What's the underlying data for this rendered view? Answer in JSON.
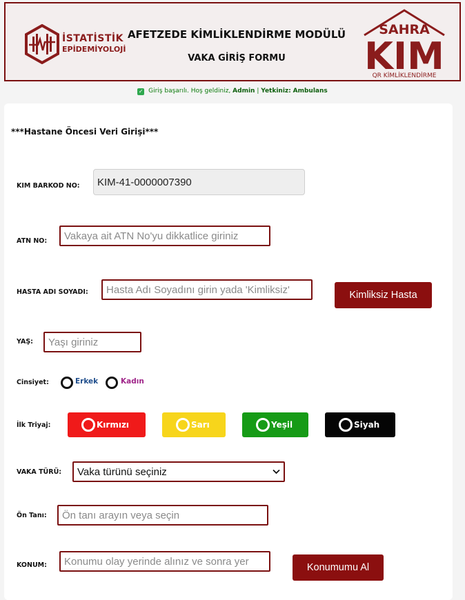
{
  "header": {
    "left_logo_line1": "İSTATİSTİK",
    "left_logo_line2": "EPİDEMİYOLOJİ",
    "title": "AFETZEDE KİMLİKLENDİRME MODÜLÜ",
    "subtitle": "VAKA GİRİŞ FORMU",
    "right_logo_top": "SAHRA",
    "right_logo_main": "KIM",
    "right_logo_bottom": "QR KİMLİKLENDİRME"
  },
  "status": {
    "prefix": "Giriş başarılı. Hoş geldiniz,",
    "user": "Admin",
    "sep": "|",
    "role_label": "Yetkiniz:",
    "role": "Ambulans"
  },
  "form": {
    "section_title": "***Hastane Öncesi Veri Girişi***",
    "barcode": {
      "label": "KIM BARKOD NO:",
      "value": "KIM-41-0000007390"
    },
    "atn": {
      "label": "ATN NO:",
      "placeholder": "Vakaya ait ATN No'yu dikkatlice giriniz"
    },
    "name": {
      "label": "HASTA ADI SOYADI:",
      "placeholder": "Hasta Adı Soyadını girin yada 'Kimliksiz'",
      "button": "Kimliksiz Hasta"
    },
    "age": {
      "label": "YAŞ:",
      "placeholder": "Yaşı giriniz"
    },
    "gender": {
      "label": "Cinsiyet:",
      "male": "Erkek",
      "female": "Kadın"
    },
    "triage": {
      "label": "İlk Triyaj:",
      "options": [
        {
          "label": "Kırmızı",
          "color": "#f01a1a"
        },
        {
          "label": "Sarı",
          "color": "#f7d51b"
        },
        {
          "label": "Yeşil",
          "color": "#169b16"
        },
        {
          "label": "Siyah",
          "color": "#050505"
        }
      ]
    },
    "case_type": {
      "label": "VAKA TÜRÜ:",
      "selected": "Vaka türünü seçiniz"
    },
    "pre_diagnosis": {
      "label": "Ön Tanı:",
      "placeholder": "Ön tanı arayın veya seçin"
    },
    "location": {
      "label": "KONUM:",
      "placeholder": "Konumu olay yerinde alınız ve sonra yer",
      "button": "Konumumu Al"
    }
  },
  "colors": {
    "accent": "#8b0f0f",
    "border": "#7a1010",
    "success": "#0b7a0b"
  }
}
